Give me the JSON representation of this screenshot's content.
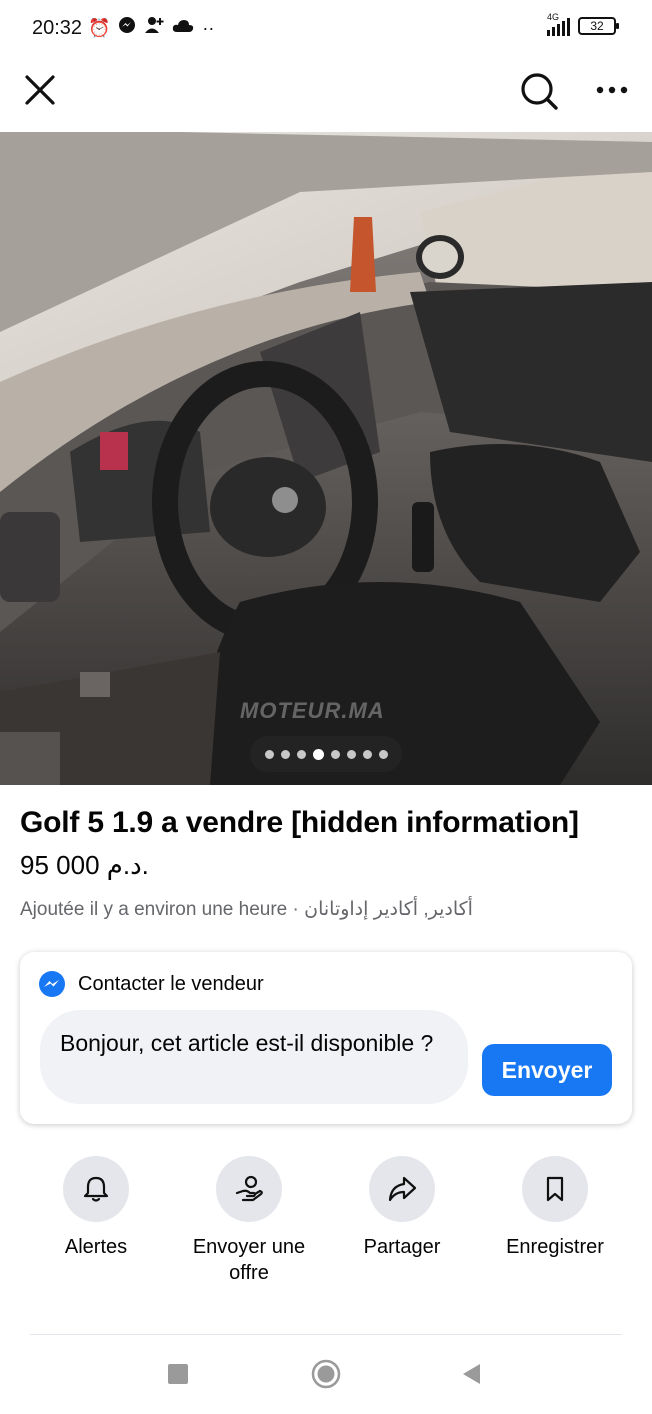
{
  "status_bar": {
    "time": "20:32",
    "icons": [
      "alarm-icon",
      "messenger-icon",
      "person-add-icon",
      "cloud-icon",
      "more-dots-icon"
    ],
    "network": "4G",
    "battery": "32"
  },
  "top_bar": {
    "close_icon": "close-icon",
    "search_icon": "search-icon",
    "more_icon": "more-horizontal-icon"
  },
  "photo": {
    "watermark": "MOTEUR.MA",
    "image_count": 8,
    "active_index": 3
  },
  "listing": {
    "title": "Golf 5 1.9 a vendre [hidden information]",
    "price": "95 000 د.م.",
    "added": "Ajoutée il y a environ une heure · ",
    "location": "أكادير, أكادير إداوتانان"
  },
  "contact": {
    "title": "Contacter le vendeur",
    "message": "Bonjour, cet article est-il disponible ?",
    "send_label": "Envoyer"
  },
  "actions": [
    {
      "label": "Alertes",
      "icon": "bell-icon"
    },
    {
      "label": "Envoyer une offre",
      "icon": "offer-icon"
    },
    {
      "label": "Partager",
      "icon": "share-icon"
    },
    {
      "label": "Enregistrer",
      "icon": "bookmark-icon"
    }
  ],
  "colors": {
    "accent": "#1877f2",
    "text": "#050505",
    "secondary_text": "#65676b",
    "action_circle": "#e4e6eb"
  }
}
